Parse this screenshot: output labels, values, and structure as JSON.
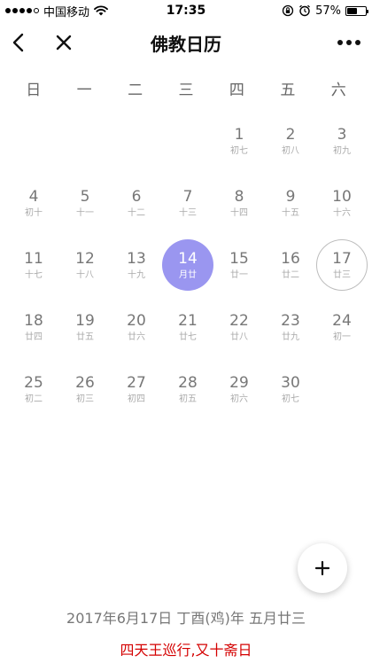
{
  "status_bar": {
    "carrier": "中国移动",
    "time": "17:35",
    "battery": "57%",
    "battery_level": 0.57,
    "icons": [
      "signal-dots-icon",
      "wifi-icon",
      "orientation-lock-icon",
      "alarm-icon",
      "battery-icon"
    ]
  },
  "nav": {
    "title": "佛教日历",
    "icons": [
      "back-arrow-icon",
      "close-icon",
      "more-dots-icon"
    ]
  },
  "weekdays": [
    "日",
    "一",
    "二",
    "三",
    "四",
    "五",
    "六"
  ],
  "calendar": {
    "leading_blanks": 4,
    "today_day": 14,
    "selected_day": 17,
    "days": [
      {
        "day": "1",
        "lunar": "初七"
      },
      {
        "day": "2",
        "lunar": "初八"
      },
      {
        "day": "3",
        "lunar": "初九"
      },
      {
        "day": "4",
        "lunar": "初十"
      },
      {
        "day": "5",
        "lunar": "十一"
      },
      {
        "day": "6",
        "lunar": "十二"
      },
      {
        "day": "7",
        "lunar": "十三"
      },
      {
        "day": "8",
        "lunar": "十四"
      },
      {
        "day": "9",
        "lunar": "十五"
      },
      {
        "day": "10",
        "lunar": "十六"
      },
      {
        "day": "11",
        "lunar": "十七"
      },
      {
        "day": "12",
        "lunar": "十八"
      },
      {
        "day": "13",
        "lunar": "十九"
      },
      {
        "day": "14",
        "lunar": "月廿"
      },
      {
        "day": "15",
        "lunar": "廿一"
      },
      {
        "day": "16",
        "lunar": "廿二"
      },
      {
        "day": "17",
        "lunar": "廿三"
      },
      {
        "day": "18",
        "lunar": "廿四"
      },
      {
        "day": "19",
        "lunar": "廿五"
      },
      {
        "day": "20",
        "lunar": "廿六"
      },
      {
        "day": "21",
        "lunar": "廿七"
      },
      {
        "day": "22",
        "lunar": "廿八"
      },
      {
        "day": "23",
        "lunar": "廿九"
      },
      {
        "day": "24",
        "lunar": "初一"
      },
      {
        "day": "25",
        "lunar": "初二"
      },
      {
        "day": "26",
        "lunar": "初三"
      },
      {
        "day": "27",
        "lunar": "初四"
      },
      {
        "day": "28",
        "lunar": "初五"
      },
      {
        "day": "29",
        "lunar": "初六"
      },
      {
        "day": "30",
        "lunar": "初七"
      }
    ]
  },
  "fab": {
    "icon": "plus-icon"
  },
  "info": {
    "date_text": "2017年6月17日 丁酉(鸡)年 五月廿三",
    "event_text": "四天王巡行,又十斋日"
  },
  "colors": {
    "today_bg": "#9a96f0",
    "event_text": "#d40000",
    "selected_border": "#bdbdbd"
  }
}
